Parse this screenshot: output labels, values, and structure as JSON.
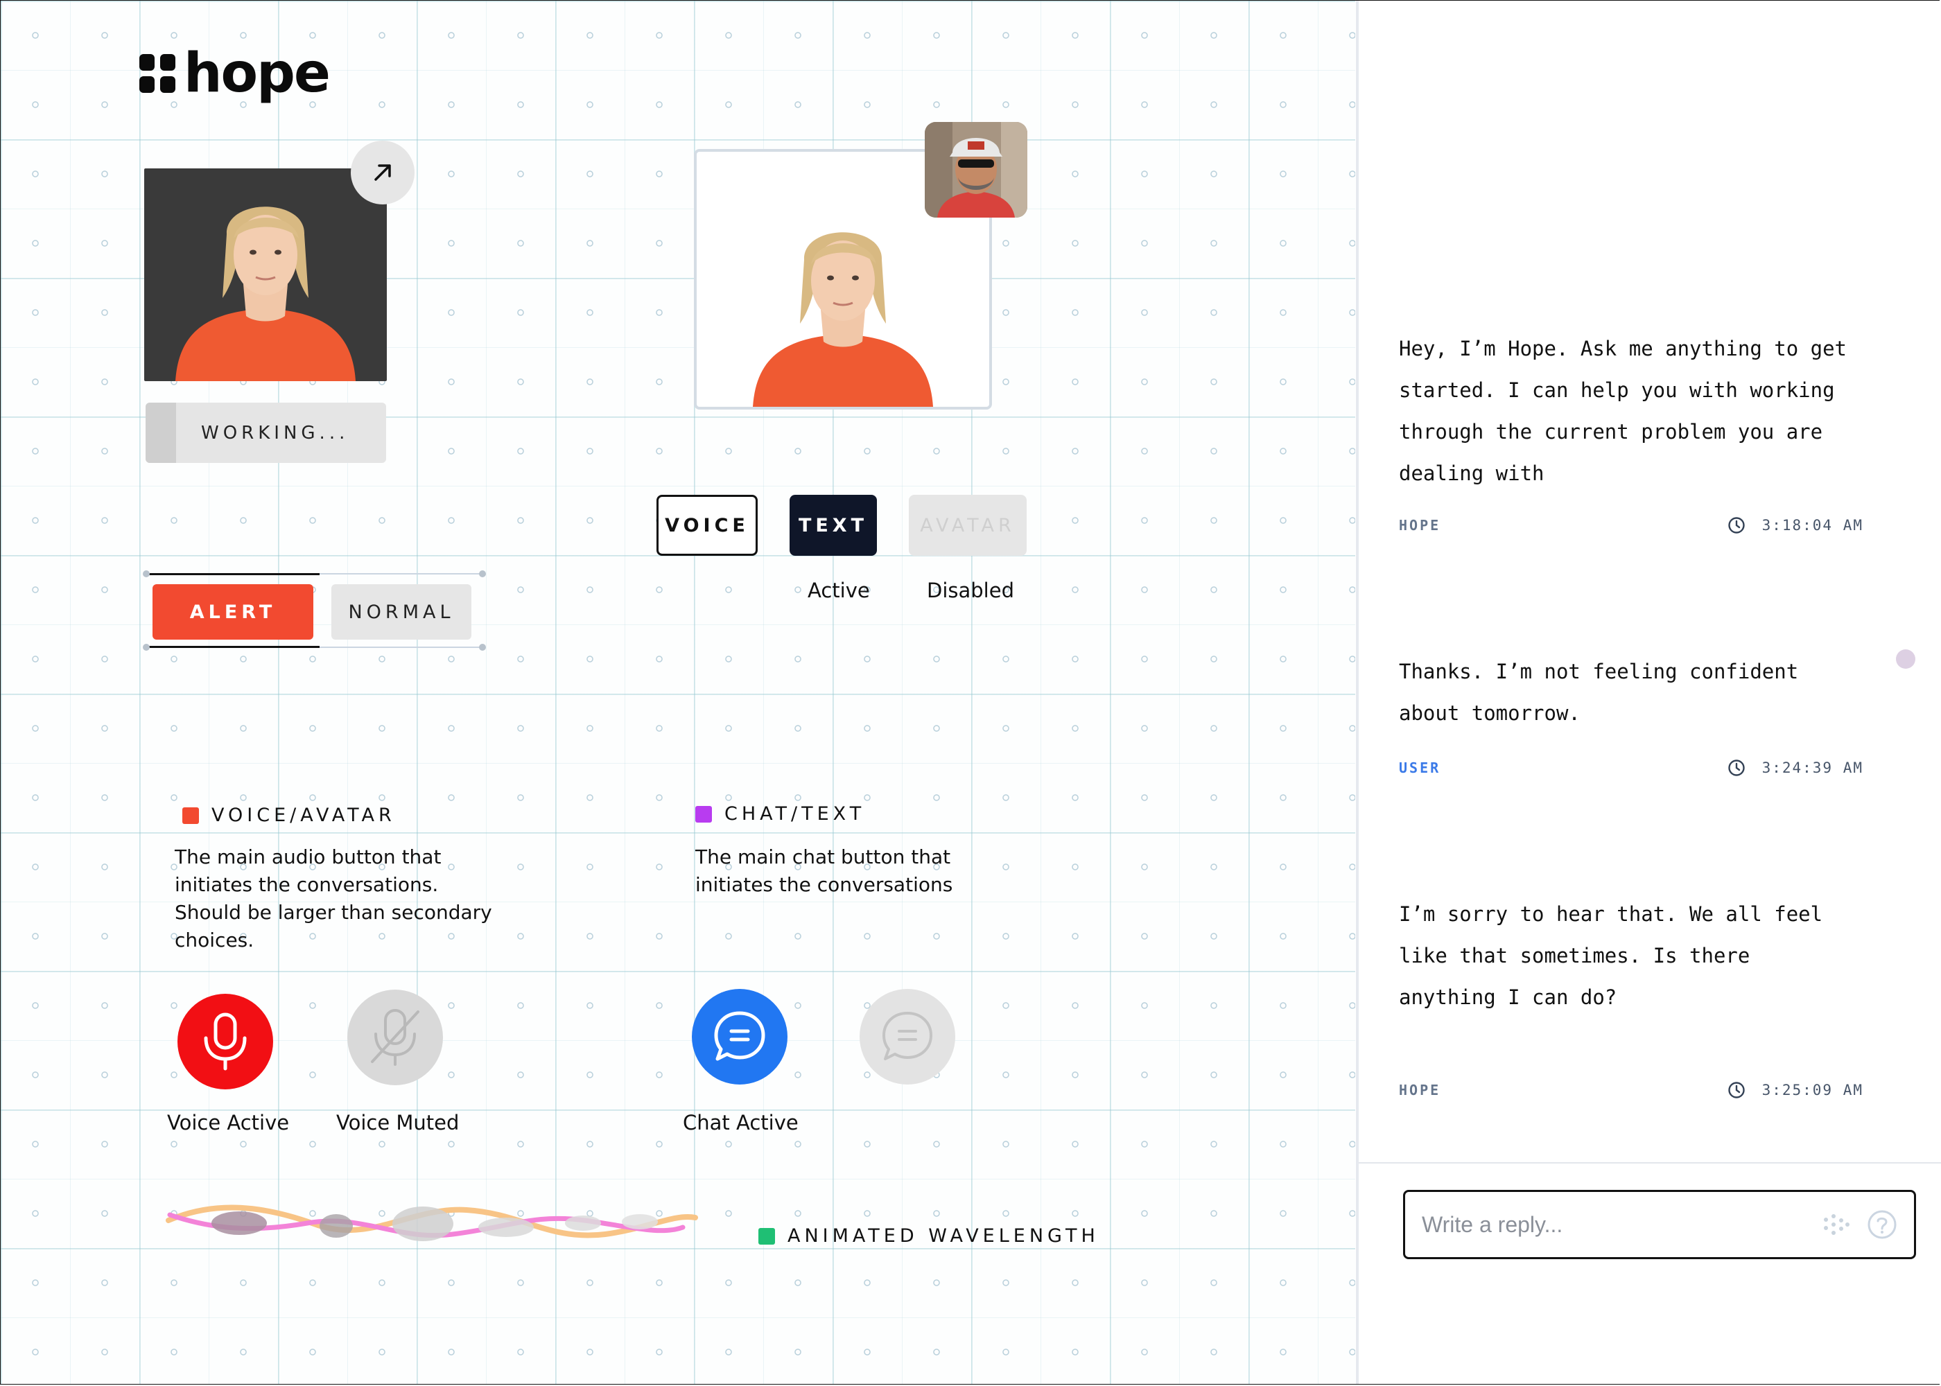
{
  "brand": {
    "name": "hope"
  },
  "status": {
    "working_label": "WORKING..."
  },
  "modes": {
    "voice_label": "VOICE",
    "text_label": "TEXT",
    "avatar_label": "AVATAR",
    "active_caption": "Active",
    "disabled_caption": "Disabled",
    "selected": "TEXT"
  },
  "alerts": {
    "alert_label": "ALERT",
    "normal_label": "NORMAL"
  },
  "legends": {
    "voice": {
      "title": "VOICE/AVATAR",
      "description": "The main audio button that initiates the conversations. Should be larger than secondary choices.",
      "color": "#f24a30"
    },
    "chat": {
      "title": "CHAT/TEXT",
      "description": "The main chat button that initiates the conversations",
      "color": "#b83cf0"
    },
    "wave": {
      "title": "ANIMATED WAVELENGTH",
      "color": "#1fbf74"
    }
  },
  "round_buttons": {
    "voice_active_caption": "Voice Active",
    "voice_muted_caption": "Voice Muted",
    "chat_active_caption": "Chat Active",
    "colors": {
      "voice_active": "#f20f14",
      "chat_active": "#2177f2",
      "muted": "#d9d9d9"
    }
  },
  "chat": {
    "messages": [
      {
        "text": "Hey, I’m Hope. Ask me anything to get started. I can help you with working through the current problem you are dealing with",
        "sender": "HOPE",
        "time": "3:18:04 AM"
      },
      {
        "text": "Thanks. I’m not feeling confident about tomorrow.",
        "sender": "USER",
        "time": "3:24:39 AM"
      },
      {
        "text": "I’m sorry to hear that. We all feel like that sometimes. Is there anything I can do?",
        "sender": "HOPE",
        "time": "3:25:09 AM"
      }
    ],
    "reply_placeholder": "Write a reply...",
    "reply_value": ""
  }
}
